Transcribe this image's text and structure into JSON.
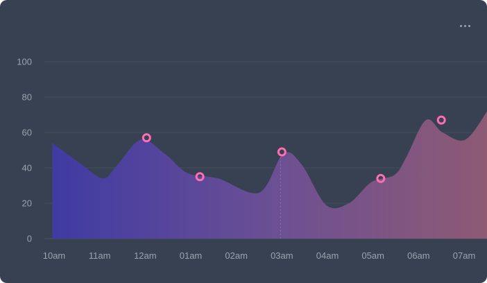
{
  "chart_data": {
    "type": "area",
    "title": "",
    "xlabel": "",
    "ylabel": "",
    "categories": [
      "10am",
      "11am",
      "12am",
      "01am",
      "02am",
      "03am",
      "04am",
      "05am",
      "06am",
      "07am"
    ],
    "ylim": [
      0,
      100
    ],
    "yticks": [
      0,
      20,
      40,
      60,
      80,
      100
    ],
    "grid": true,
    "legend": "none",
    "series": [
      {
        "x": [
          -0.04,
          0.6,
          1.07,
          1.37,
          1.9,
          2.43,
          2.93,
          3.6,
          4.5,
          5.03,
          5.43,
          5.97,
          6.47,
          6.97,
          7.47,
          7.73,
          8.16,
          8.53,
          9.03,
          9.53
        ],
        "values": [
          54,
          42,
          34,
          41,
          56,
          48,
          37,
          34,
          26,
          48,
          42,
          19,
          20,
          32,
          36,
          46,
          67,
          60,
          56,
          73
        ]
      }
    ],
    "markers": [
      {
        "x": 2.03,
        "y": 57
      },
      {
        "x": 3.2,
        "y": 35
      },
      {
        "x": 5.0,
        "y": 49
      },
      {
        "x": 7.17,
        "y": 34
      },
      {
        "x": 8.5,
        "y": 67
      }
    ],
    "gradient": [
      "#3f3ba3",
      "#6b4f94",
      "#8e5a74"
    ],
    "marker_color": "#ff6eb4",
    "guide_x": 4.97
  },
  "menu_icon": "more-horizontal-icon"
}
